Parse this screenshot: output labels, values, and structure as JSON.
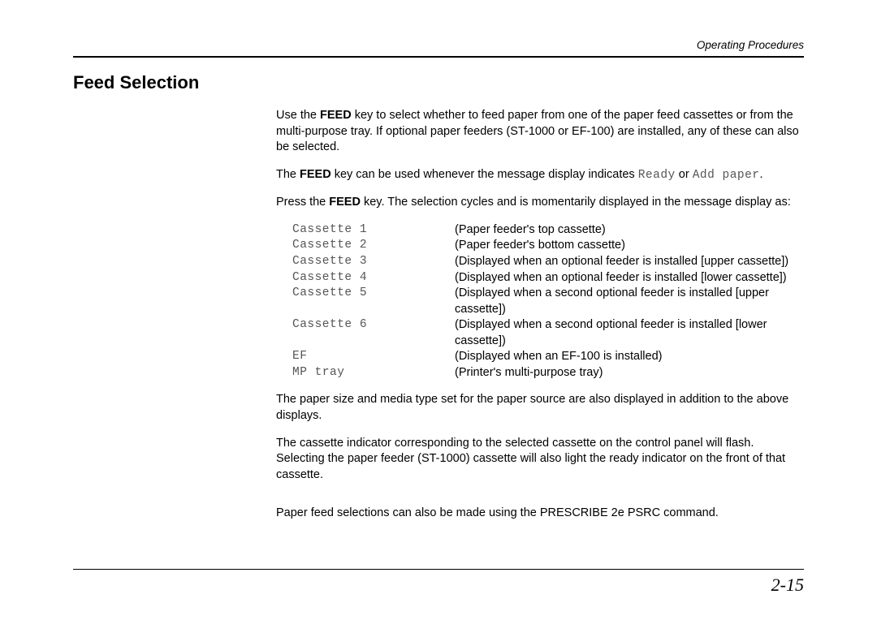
{
  "header": {
    "running_head": "Operating Procedures"
  },
  "title": "Feed Selection",
  "intro": {
    "p1_prefix": "Use the ",
    "p1_key": "FEED",
    "p1_suffix": " key to select whether to feed paper from one of the paper feed cassettes or from the multi-purpose tray.  If optional paper feeders (ST-1000 or EF-100) are installed, any of these can also be selected.",
    "p2_prefix": "The ",
    "p2_key": "FEED",
    "p2_middle": " key can be used whenever the message display indicates ",
    "p2_mono1": "Ready",
    "p2_or": " or ",
    "p2_mono2": "Add paper",
    "p2_end": ".",
    "p3_prefix": "Press the ",
    "p3_key": "FEED",
    "p3_suffix": " key. The selection cycles and is momentarily displayed in the message display as:"
  },
  "cassettes": [
    {
      "label": "Cassette 1",
      "desc": "(Paper feeder's top cassette)"
    },
    {
      "label": "Cassette 2",
      "desc": "(Paper feeder's bottom cassette)"
    },
    {
      "label": "Cassette 3",
      "desc": "(Displayed when an optional feeder is installed [upper cassette])"
    },
    {
      "label": "Cassette 4",
      "desc": "(Displayed when an optional feeder is installed [lower cassette])"
    },
    {
      "label": "Cassette 5",
      "desc": "(Displayed when a second optional feeder is installed [upper cassette])"
    },
    {
      "label": "Cassette 6",
      "desc": "(Displayed when a second optional feeder is installed [lower cassette])"
    },
    {
      "label": "EF",
      "desc": "(Displayed when an EF-100 is installed)"
    },
    {
      "label": "MP tray",
      "desc": "(Printer's multi-purpose tray)"
    }
  ],
  "after": {
    "p1": "The paper size and media type set for the paper source are also displayed in addition to the above displays.",
    "p2": "The cassette indicator corresponding to the selected cassette on the control panel will flash.  Selecting the paper feeder (ST-1000) cassette will also light the ready indicator on the front of that cassette.",
    "p3": "Paper feed selections can also be made using the PRESCRIBE 2e PSRC command."
  },
  "footer": {
    "page_number": "2-15"
  }
}
